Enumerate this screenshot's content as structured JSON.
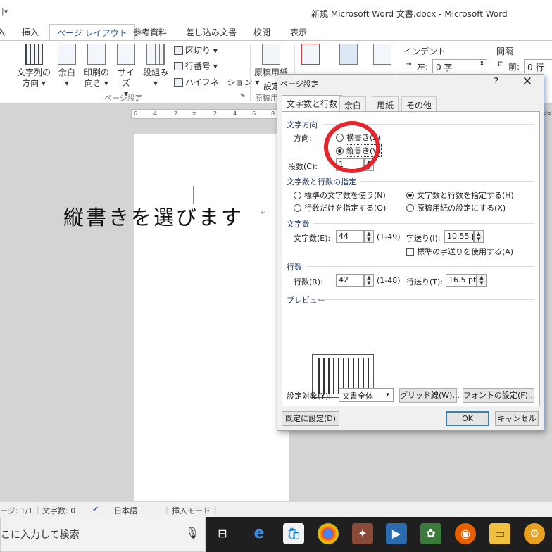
{
  "window": {
    "qat_glyph": "|▾",
    "title": "新規 Microsoft Word 文書.docx - Microsoft Word"
  },
  "ribbon_tabs": [
    {
      "label": "入"
    },
    {
      "label": "挿入"
    },
    {
      "label": "ページ レイアウト",
      "active": true
    },
    {
      "label": "参考資料"
    },
    {
      "label": "差し込み文書"
    },
    {
      "label": "校閲"
    },
    {
      "label": "表示"
    }
  ],
  "ribbon": {
    "text_direction": "文字列の\n方向 ▾",
    "margins": "余白\n▾",
    "orientation": "印刷の\n向き ▾",
    "size": "サイズ\n▾",
    "columns": "段組み\n▾",
    "breaks": "区切り ▾",
    "line_numbers": "行番号 ▾",
    "hyphenation": "ハイフネーション ▾",
    "group_page_setup": "ページ設定",
    "manuscript_label_1": "原稿用紙",
    "manuscript_label_2": "設定",
    "manuscript_group": "原稿用",
    "watermark_partial": "透かし",
    "page_color_partial": "ページの色",
    "page_border_partial": "ページ",
    "indent_header": "インデント",
    "indent_left_label": "左:",
    "indent_left_value": "0 字",
    "spacing_header": "間隔",
    "spacing_before_label": "前:",
    "spacing_before_value": "0 行"
  },
  "ruler": [
    "6",
    "4",
    "2",
    "2",
    "4",
    "6",
    "8",
    "36"
  ],
  "document": {
    "text": "縦書きを選びます",
    "para_mark": "↵"
  },
  "dialog": {
    "title": "ページ設定",
    "help": "?",
    "close": "✕",
    "tabs": [
      "文字数と行数",
      "余白",
      "用紙",
      "その他"
    ],
    "section_text_direction": "文字方向",
    "direction_label": "方向:",
    "horizontal": "横書き(Z)",
    "vertical": "縦書き(V)",
    "columns_label": "段数(C):",
    "columns_value": "1",
    "section_grid": "文字数と行数の指定",
    "grid_options": [
      "標準の文字数を使う(N)",
      "文字数と行数を指定する(H)",
      "行数だけを指定する(O)",
      "原稿用紙の設定にする(X)"
    ],
    "selected_grid": "文字数と行数を指定する(H)",
    "section_chars": "文字数",
    "chars_label": "文字数(E):",
    "chars_value": "44",
    "chars_range": "(1-49)",
    "char_pitch_label": "字送り(I):",
    "char_pitch_value": "10.55 p",
    "use_default_pitch": "標準の字送りを使用する(A)",
    "section_lines": "行数",
    "lines_label": "行数(R):",
    "lines_value": "42",
    "lines_range": "(1-48)",
    "line_pitch_label": "行送り(T):",
    "line_pitch_value": "16.5 pt",
    "section_preview": "プレビュー",
    "apply_to_label": "設定対象(Y):",
    "apply_to_value": "文書全体",
    "grid_button": "グリッド線(W)...",
    "font_button": "フォントの設定(F)...",
    "default_button": "既定に設定(D)",
    "ok_button": "OK",
    "cancel_button": "キャンセル"
  },
  "statusbar": {
    "page": "ージ: 1/1",
    "words": "文字数: 0",
    "language": "日本語",
    "mode": "挿入モード"
  },
  "taskbar": {
    "search_text": "こに入力して検索",
    "icons": [
      "task-view-icon",
      "edge-icon",
      "store-icon",
      "chrome-icon",
      "app-icon",
      "media-player-icon",
      "app-icon-2",
      "firefox-icon",
      "file-explorer-icon",
      "settings-icon"
    ]
  },
  "accent_colors": {
    "word_blue": "#2b579a",
    "highlight_circle": "#e3262e",
    "taskbar": "#1f1f1f"
  }
}
